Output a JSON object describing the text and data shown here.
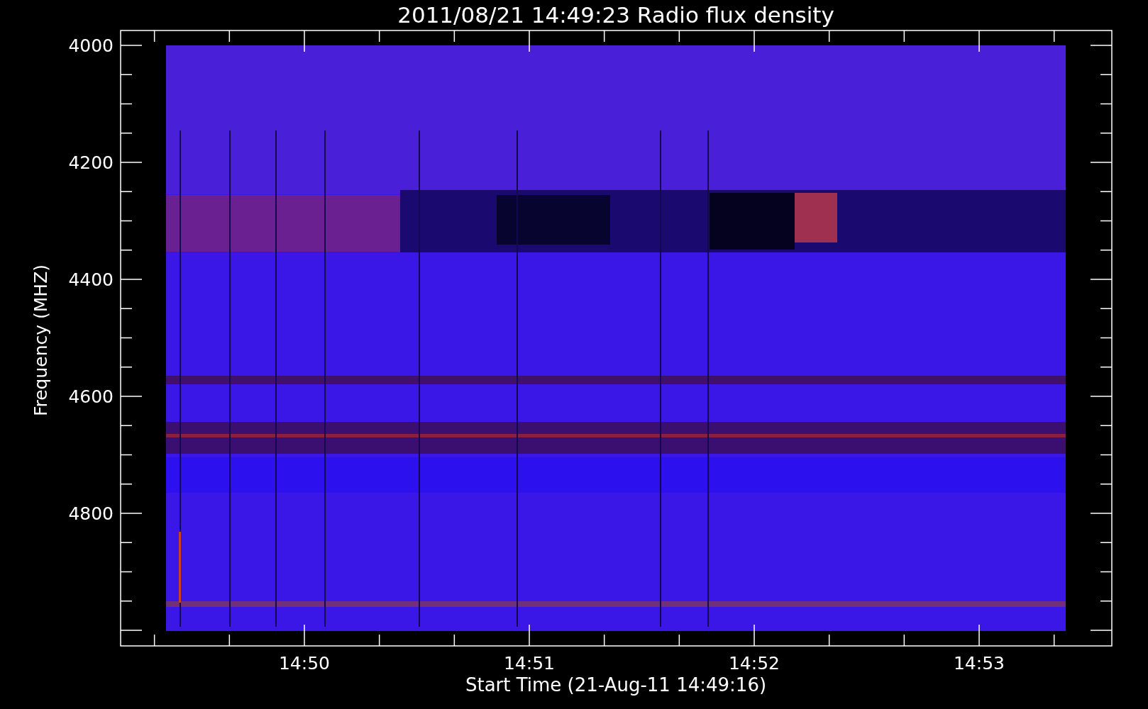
{
  "title": "2011/08/21 14:49:23 Radio flux density",
  "plot": {
    "ylabel": "Frequency (MHZ)",
    "xlabel": "Start Time (21-Aug-11 14:49:16)",
    "yticks": [
      "4000",
      "4200",
      "4400",
      "4600",
      "4800"
    ],
    "xticks": [
      "14:50",
      "14:51",
      "14:52",
      "14:53"
    ]
  }
}
